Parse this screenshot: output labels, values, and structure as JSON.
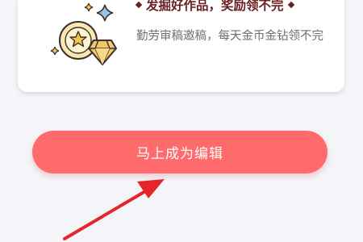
{
  "card": {
    "title": "发掘好作品，奖励领不完",
    "description": "勤劳审稿邀稿，每天金币金钻领不完",
    "icon": "coin-diamond-icon"
  },
  "cta": {
    "label": "马上成为编辑",
    "color": "#ff6b6c"
  },
  "annotation": {
    "icon": "red-arrow-icon",
    "color": "#e5252a"
  }
}
